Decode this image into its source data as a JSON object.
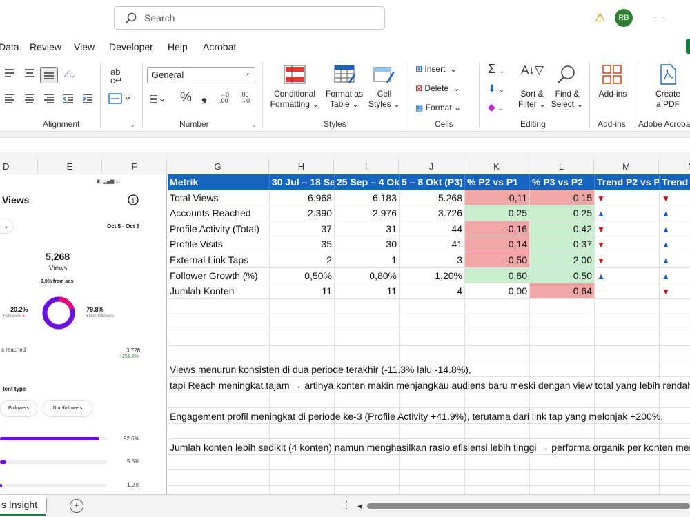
{
  "search": {
    "placeholder": "Search"
  },
  "user": {
    "initials": "RB"
  },
  "menu": [
    "Data",
    "Review",
    "View",
    "Developer",
    "Help",
    "Acrobat"
  ],
  "ribbon": {
    "number_format": "General",
    "groups": {
      "alignment": "Alignment",
      "number": "Number",
      "styles": "Styles",
      "cells": "Cells",
      "editing": "Editing",
      "addins": "Add-ins",
      "adobe": "Adobe Acroba"
    },
    "buttons": {
      "conditional": "Conditional",
      "formatting": "Formatting",
      "format_as": "Format as",
      "table": "Table",
      "cell": "Cell",
      "cell_styles": "Styles",
      "insert": "Insert",
      "delete": "Delete",
      "format": "Format",
      "sort": "Sort &",
      "filter": "Filter",
      "find": "Find &",
      "select": "Select",
      "addins": "Add-ins",
      "create": "Create",
      "pdf": "a PDF"
    }
  },
  "columns": [
    "D",
    "E",
    "F",
    "G",
    "H",
    "I",
    "J",
    "K",
    "L",
    "M",
    "N"
  ],
  "phone": {
    "title": "Views",
    "date_range": "Oct 5 - Oct 8",
    "total": "5,268",
    "total_label": "Views",
    "ads": "0.0% from ads",
    "followers_pct": "20.2%",
    "followers_label": "Followers",
    "nonfollowers_pct": "79.8%",
    "nonfollowers_label": "Non-followers",
    "reached_label": "s reached",
    "reached_value": "3,726",
    "reached_change": "+251.2%",
    "content_type": "tent type",
    "chip_followers": "Followers",
    "chip_nonfollowers": "Non-followers",
    "bar1": "92.6%",
    "bar2": "5.5%",
    "bar3": "1.9%",
    "bar1_fill": 0.926,
    "bar2_fill": 0.055,
    "bar3_fill": 0.019,
    "donut_followers_fraction": 0.202
  },
  "table": {
    "headers": [
      "Metrik",
      "30 Jul – 18 Se",
      "25 Sep – 4 Ok",
      "5 – 8 Okt (P3)",
      "% P2 vs P1",
      "% P3 vs P2",
      "Trend P2 vs P",
      "Trend"
    ],
    "rows": [
      [
        "Total Views",
        "6.968",
        "6.183",
        "5.268",
        "-0,11",
        "-0,15",
        "▼",
        "▼"
      ],
      [
        "Accounts Reached",
        "2.390",
        "2.976",
        "3.726",
        "0,25",
        "0,25",
        "▲",
        "▲"
      ],
      [
        "Profile Activity (Total)",
        "37",
        "31",
        "44",
        "-0,16",
        "0,42",
        "▼",
        "▲"
      ],
      [
        "Profile Visits",
        "35",
        "30",
        "41",
        "-0,14",
        "0,37",
        "▼",
        "▲"
      ],
      [
        "External Link Taps",
        "2",
        "1",
        "3",
        "-0,50",
        "2,00",
        "▼",
        "▲"
      ],
      [
        "Follower Growth (%)",
        "0,50%",
        "0,80%",
        "1,20%",
        "0,60",
        "0,50",
        "▲",
        "▲"
      ],
      [
        "Jumlah Konten",
        "11",
        "11",
        "4",
        "0,00",
        "-0,64",
        "–",
        "▼"
      ]
    ],
    "fills": [
      [
        "",
        "",
        "",
        "",
        "red",
        "red",
        "",
        ""
      ],
      [
        "",
        "",
        "",
        "",
        "grn",
        "grn",
        "",
        ""
      ],
      [
        "",
        "",
        "",
        "",
        "red",
        "grn",
        "",
        ""
      ],
      [
        "",
        "",
        "",
        "",
        "red",
        "grn",
        "",
        ""
      ],
      [
        "",
        "",
        "",
        "",
        "red",
        "grn",
        "",
        ""
      ],
      [
        "",
        "",
        "",
        "",
        "grn",
        "grn",
        "",
        ""
      ],
      [
        "",
        "",
        "",
        "",
        "",
        "red",
        "",
        ""
      ]
    ]
  },
  "notes": [
    "Views menurun konsisten di dua periode terakhir (-11.3% lalu -14.8%),",
    "tapi Reach meningkat tajam → artinya konten makin menjangkau audiens baru meski dengan view total yang lebih rendah",
    "Engagement profil meningkat di periode ke-3 (Profile Activity +41.9%), terutama dari link tap yang melonjak +200%.",
    "Jumlah konten lebih sedikit (4 konten) namun menghasilkan rasio efisiensi lebih tinggi → performa organik per konten men"
  ],
  "sheet": {
    "tab": "s Insight"
  },
  "colors": {
    "header_blue": "#1565c0",
    "neg_fill": "#f2a6a6",
    "pos_fill": "#c8efce",
    "accent_purple": "#6a11e0",
    "excel_green": "#107c41"
  }
}
